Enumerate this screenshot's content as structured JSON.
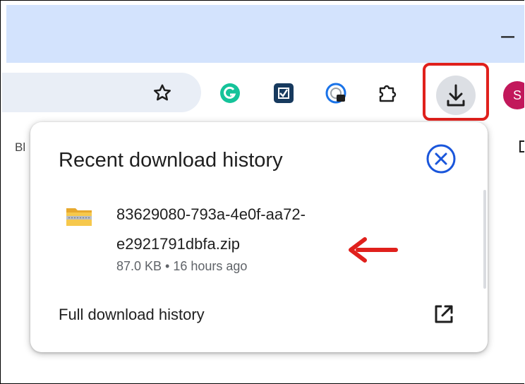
{
  "window": {
    "minimize_glyph": "–"
  },
  "toolbar": {
    "icons": [
      "star-icon",
      "grammarly-icon",
      "extension-checkbox-icon",
      "password-manager-icon",
      "puzzle-extensions-icon",
      "download-icon"
    ],
    "avatar_letter": "S",
    "highlight_color": "#e0201c"
  },
  "bookmarks": {
    "partial_text": "Bl"
  },
  "downloads_popup": {
    "title": "Recent download history",
    "item": {
      "name_line1": "83629080-793a-4e0f-aa72-",
      "name_line2": "e2921791dbfa.zip",
      "meta": "87.0 KB • 16 hours ago",
      "icon": "zip-folder-icon"
    },
    "footer_label": "Full download history",
    "annotation_arrow_color": "#e0201c"
  }
}
